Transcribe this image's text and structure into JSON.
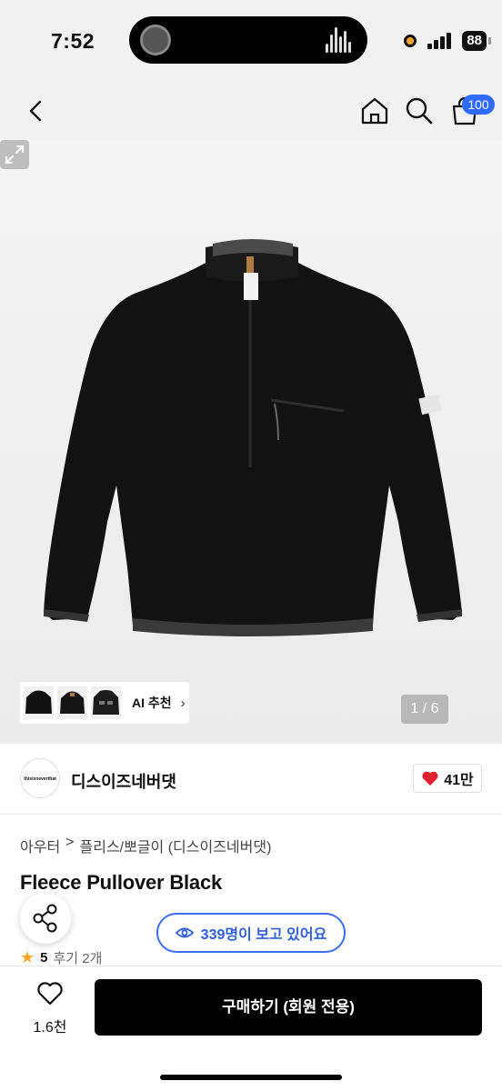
{
  "status_bar": {
    "time": "7:52",
    "battery": "88"
  },
  "header": {
    "cart_count": "100"
  },
  "gallery": {
    "ai_recommend_label": "AI 추천",
    "ai_chevron": "›",
    "page_indicator": "1 / 6"
  },
  "brand": {
    "logo_text": "thisisneverthat",
    "name": "디스이즈네버댓",
    "like_count": "41만"
  },
  "product": {
    "breadcrumb": [
      "아우터",
      "플리스/뽀글이 (디스이즈네버댓)"
    ],
    "breadcrumb_separator": ">",
    "title": "Fleece Pullover Black",
    "viewers_text": "339명이 보고 있어요",
    "rating_star": "★",
    "rating": "5",
    "reviews": "후기 2개"
  },
  "bottom_bar": {
    "wishlist_count": "1.6천",
    "buy_label": "구매하기 (회원 전용)"
  },
  "colors": {
    "accent_blue": "#2f6bff",
    "heart_red": "#e5202e",
    "buy_button": "#000000"
  }
}
